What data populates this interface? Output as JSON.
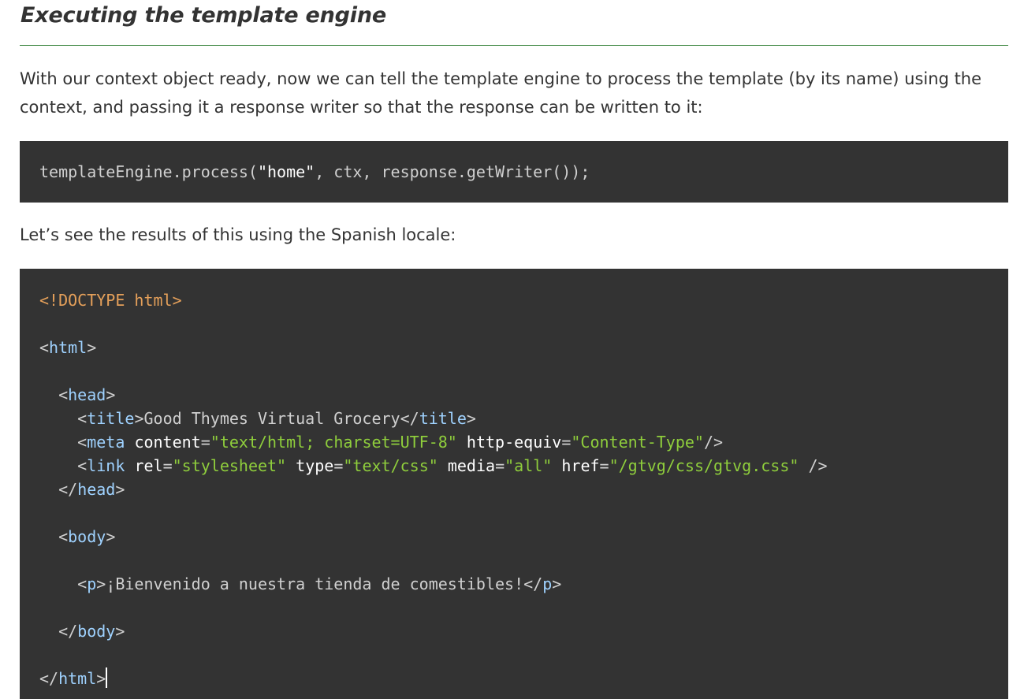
{
  "section": {
    "heading": "Executing the template engine",
    "intro": "With our context object ready, now we can tell the template engine to process the template (by its name) using the context, and passing it a response writer so that the response can be written to it:",
    "code1": {
      "pre": "templateEngine.process(",
      "str": "\"home\"",
      "post": ", ctx, response.getWriter());"
    },
    "followup": "Let’s see the results of this using the Spanish locale:"
  },
  "code2": {
    "doctype": "<!DOCTYPE html>",
    "html_tag": "html",
    "head_tag": "head",
    "title_tag": "title",
    "title_text": "Good Thymes Virtual Grocery",
    "meta_tag": "meta",
    "meta_attr1": "content",
    "meta_val1": "\"text/html; charset=UTF-8\"",
    "meta_attr2": "http-equiv",
    "meta_val2": "\"Content-Type\"",
    "link_tag": "link",
    "link_attr1": "rel",
    "link_val1": "\"stylesheet\"",
    "link_attr2": "type",
    "link_val2": "\"text/css\"",
    "link_attr3": "media",
    "link_val3": "\"all\"",
    "link_attr4": "href",
    "link_val4": "\"/gtvg/css/gtvg.css\"",
    "body_tag": "body",
    "p_tag": "p",
    "p_text": "¡Bienvenido a nuestra tienda de comestibles!"
  },
  "colors": {
    "rule": "#2e7d32",
    "code_bg": "#333333",
    "tag": "#9fd2ff",
    "value": "#8fce3c",
    "doctype": "#e5a05a"
  }
}
